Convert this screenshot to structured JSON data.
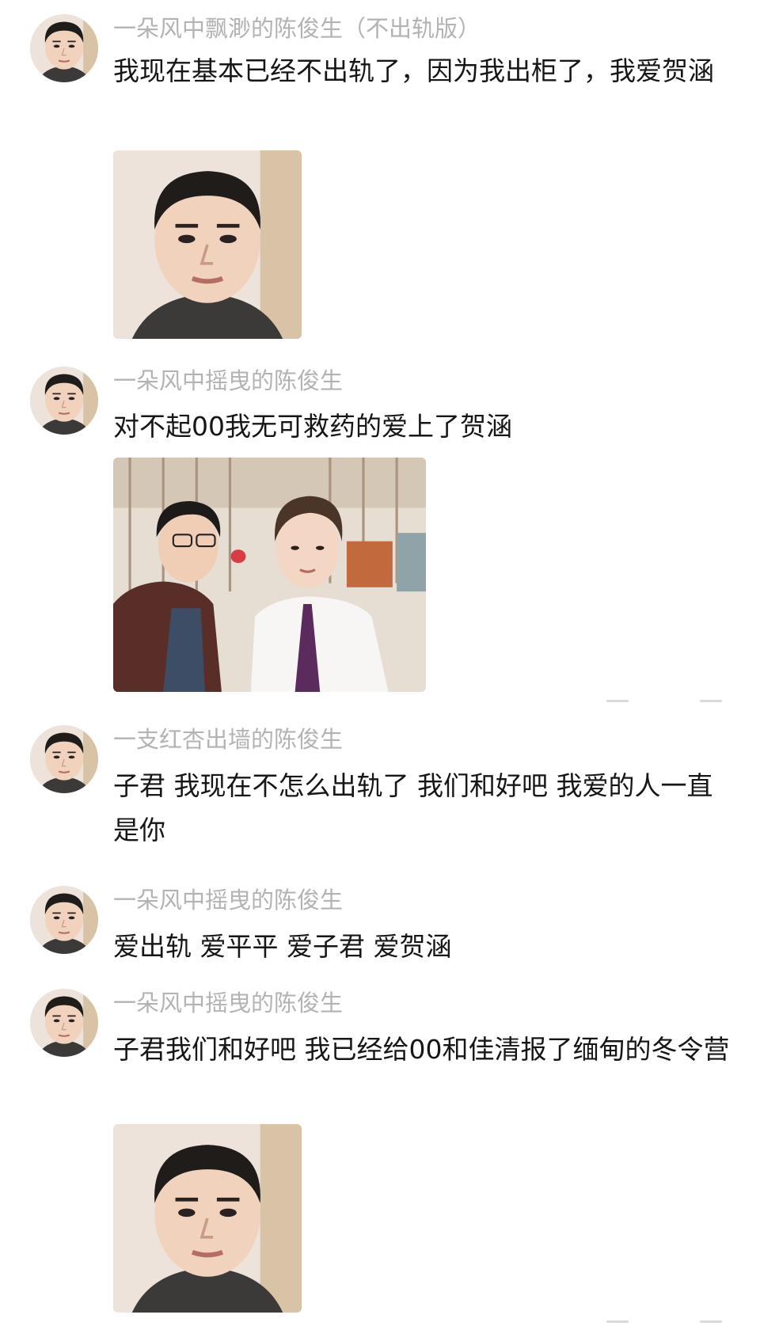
{
  "comments": [
    {
      "username": "一朵风中飘渺的陈俊生（不出轨版）",
      "text": "我现在基本已经不出轨了，因为我出柜了，我爱贺涵",
      "has_photo": true
    },
    {
      "username": "一朵风中摇曳的陈俊生",
      "text": "对不起00我无可救药的爱上了贺涵",
      "has_photo": true
    },
    {
      "username": "一支红杏出墙的陈俊生",
      "text": "子君 我现在不怎么出轨了 我们和好吧 我爱的人一直是你",
      "has_photo": false
    },
    {
      "username": "一朵风中摇曳的陈俊生",
      "text": "爱出轨 爱平平 爱子君 爱贺涵",
      "has_photo": false
    },
    {
      "username": "一朵风中摇曳的陈俊生",
      "text": "子君我们和好吧 我已经给00和佳清报了缅甸的冬令营",
      "has_photo": true
    }
  ],
  "colors": {
    "username": "#b3b3b3",
    "text": "#161616",
    "background": "#ffffff"
  }
}
